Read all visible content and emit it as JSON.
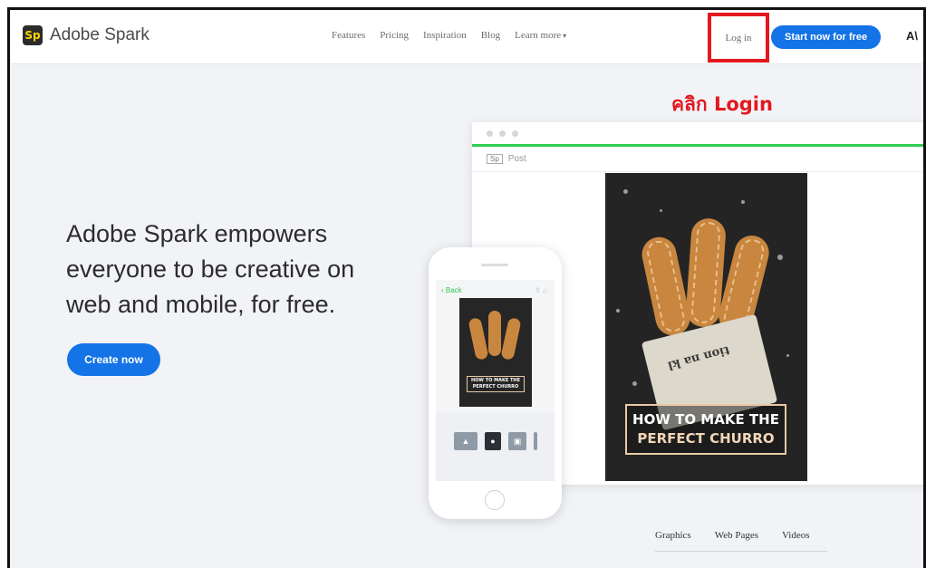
{
  "header": {
    "logo_badge": "Sp",
    "logo_text": "Adobe Spark",
    "nav": [
      "Features",
      "Pricing",
      "Inspiration",
      "Blog",
      "Learn more"
    ],
    "login": "Log in",
    "cta": "Start now for free",
    "adobe_mark": "A\\"
  },
  "annotation": "คลิก Login",
  "hero": {
    "title": "Adobe Spark empowers everyone to be creative on web and mobile, for free.",
    "button": "Create now"
  },
  "desktop_mockup": {
    "tab_icon": "Sp",
    "tab_label": "Post",
    "poster_line1": "HOW TO MAKE THE",
    "poster_line2": "PERFECT CHURRO",
    "wrapper_text": "tion na kl"
  },
  "phone_mockup": {
    "back_label": "‹ Back",
    "poster_line1": "HOW TO MAKE THE",
    "poster_line2": "PERFECT CHURRO"
  },
  "bottom_tabs": [
    "Graphics",
    "Web Pages",
    "Videos"
  ],
  "colors": {
    "accent": "#1473e6",
    "annotation": "#e3181e",
    "green": "#2ecc52",
    "background": "#f1f3f7"
  }
}
